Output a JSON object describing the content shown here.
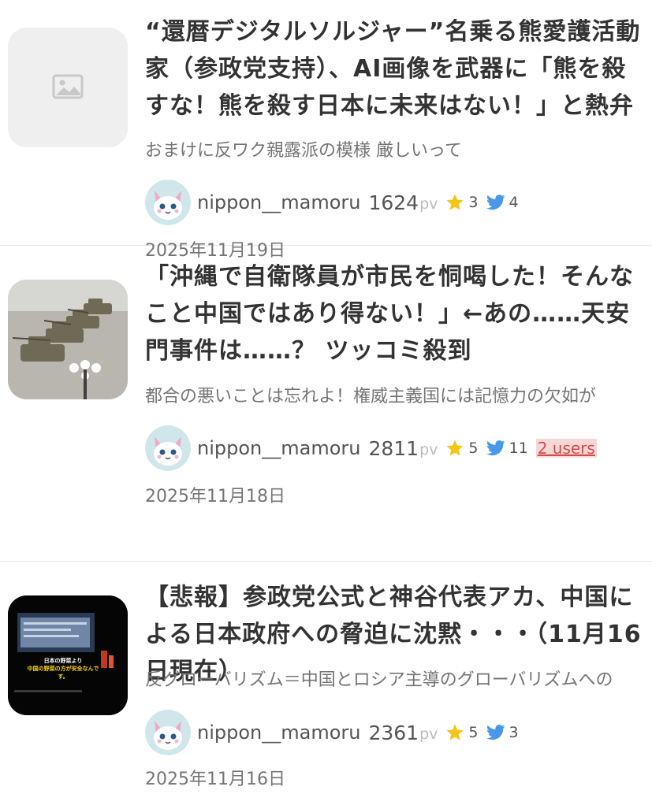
{
  "articles": [
    {
      "title": "“還暦デジタルソルジャー”名乗る熊愛護活動家（参政党支持）、AI画像を武器に「熊を殺すな！熊を殺す日本に未来はない！」と熱弁",
      "excerpt": "おまけに反ワク親露派の模様 厳しいって",
      "author": "nippon__mamoru",
      "pv": "1624",
      "pv_unit": "pv",
      "stars": "3",
      "tweets": "4",
      "users": "",
      "date": "2025年11月19日",
      "thumbnail": "image-placeholder-icon"
    },
    {
      "title": "「沖縄で自衛隊員が市民を恫喝した！そんなこと中国ではあり得ない！」←あの……天安門事件は……？ ツッコミ殺到",
      "excerpt": "都合の悪いことは忘れよ！権威主義国には記憶力の欠如が",
      "author": "nippon__mamoru",
      "pv": "2811",
      "pv_unit": "pv",
      "stars": "5",
      "tweets": "11",
      "users": "2 users",
      "date": "2025年11月18日",
      "thumbnail": "tanks-photo"
    },
    {
      "title": "【悲報】参政党公式と神谷代表アカ、中国による日本政府への脅迫に沈黙・・・（11月16日現在）",
      "excerpt": "反グローバリズム＝中国とロシア主導のグローバリズムへの",
      "author": "nippon__mamoru",
      "pv": "2361",
      "pv_unit": "pv",
      "stars": "5",
      "tweets": "3",
      "users": "",
      "date": "2025年11月16日",
      "thumbnail": "stage-screen-photo",
      "thumbnail_caption_1": "日本の野菜より",
      "thumbnail_caption_2": "中国の野菜の方が安全なんです。"
    }
  ],
  "colors": {
    "star": "#f5c518",
    "bird": "#4a99e9",
    "users_badge_text": "#d44b4b",
    "users_badge_bg": "#f8d7d7"
  }
}
